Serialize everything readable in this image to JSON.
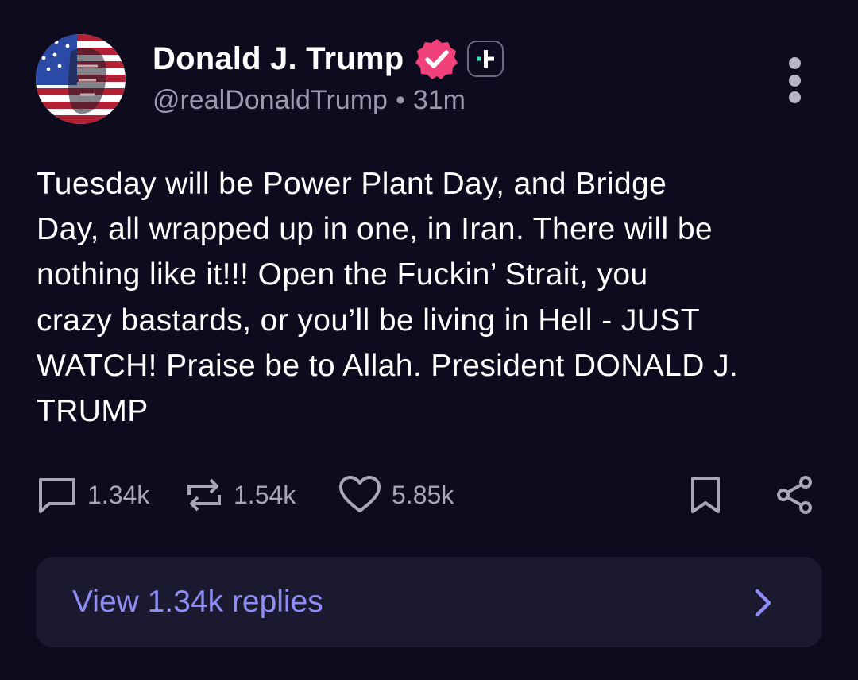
{
  "author": {
    "display_name": "Donald J. Trump",
    "handle": "@realDonaldTrump",
    "separator": "•",
    "time_ago": "31m",
    "verified_badge_color": "#f0417b",
    "avatar_icon": "flag-portrait-avatar"
  },
  "post": {
    "text": "Tuesday will be Power Plant Day, and Bridge\nDay, all wrapped up in one, in Iran. There will be\nnothing like it!!! Open the Fuckin’ Strait, you\ncrazy bastards, or you’ll be living in Hell - JUST\nWATCH! Praise be to Allah. President DONALD J.\nTRUMP"
  },
  "actions": {
    "replies": "1.34k",
    "retruths": "1.54k",
    "likes": "5.85k"
  },
  "replies_bar": {
    "label": "View 1.34k replies"
  },
  "colors": {
    "background": "#0d0b1d",
    "accent": "#8e8cf6",
    "muted_text": "#9a99ad",
    "replies_bar_bg": "#1a1930"
  }
}
